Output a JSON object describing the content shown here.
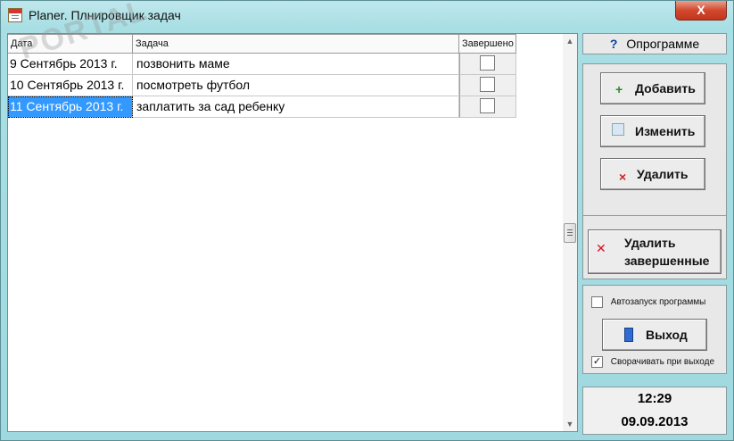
{
  "window": {
    "title": "Planer. Плнировщик задач",
    "close_label": "X",
    "watermark": "PORTAL"
  },
  "grid": {
    "columns": [
      "Дата",
      "Задача",
      "Завершено"
    ],
    "rows": [
      {
        "date": "9 Сентябрь 2013 г.",
        "task": "позвонить маме",
        "done": false
      },
      {
        "date": "10 Сентябрь 2013 г.",
        "task": "посмотреть футбол",
        "done": false
      },
      {
        "date": "11 Сентябрь 2013 г.",
        "task": "заплатить за сад ребенку",
        "done": false
      }
    ]
  },
  "sidebar": {
    "about_label": "Опрограмме",
    "add_label": "Добавить",
    "edit_label": "Изменить",
    "delete_label": "Удалить",
    "delete_done_label_1": "Удалить",
    "delete_done_label_2": "завершенные",
    "autostart_label": "Автозапуск программы",
    "autostart_checked": false,
    "exit_label": "Выход",
    "minimize_on_exit_label": "Сворачивать при выходе",
    "minimize_on_exit_checked": true
  },
  "clock": {
    "time": "12:29",
    "date": "09.09.2013"
  },
  "icons": {
    "app": "calendar-icon",
    "about": "help-icon",
    "add": "add-icon",
    "edit": "edit-icon",
    "delete": "delete-icon",
    "delete_done": "delete-all-icon",
    "exit": "exit-icon"
  },
  "colors": {
    "title_bg": "#bfe7ec",
    "selected_bg": "#3399ff",
    "close_bg": "#d2492f"
  }
}
